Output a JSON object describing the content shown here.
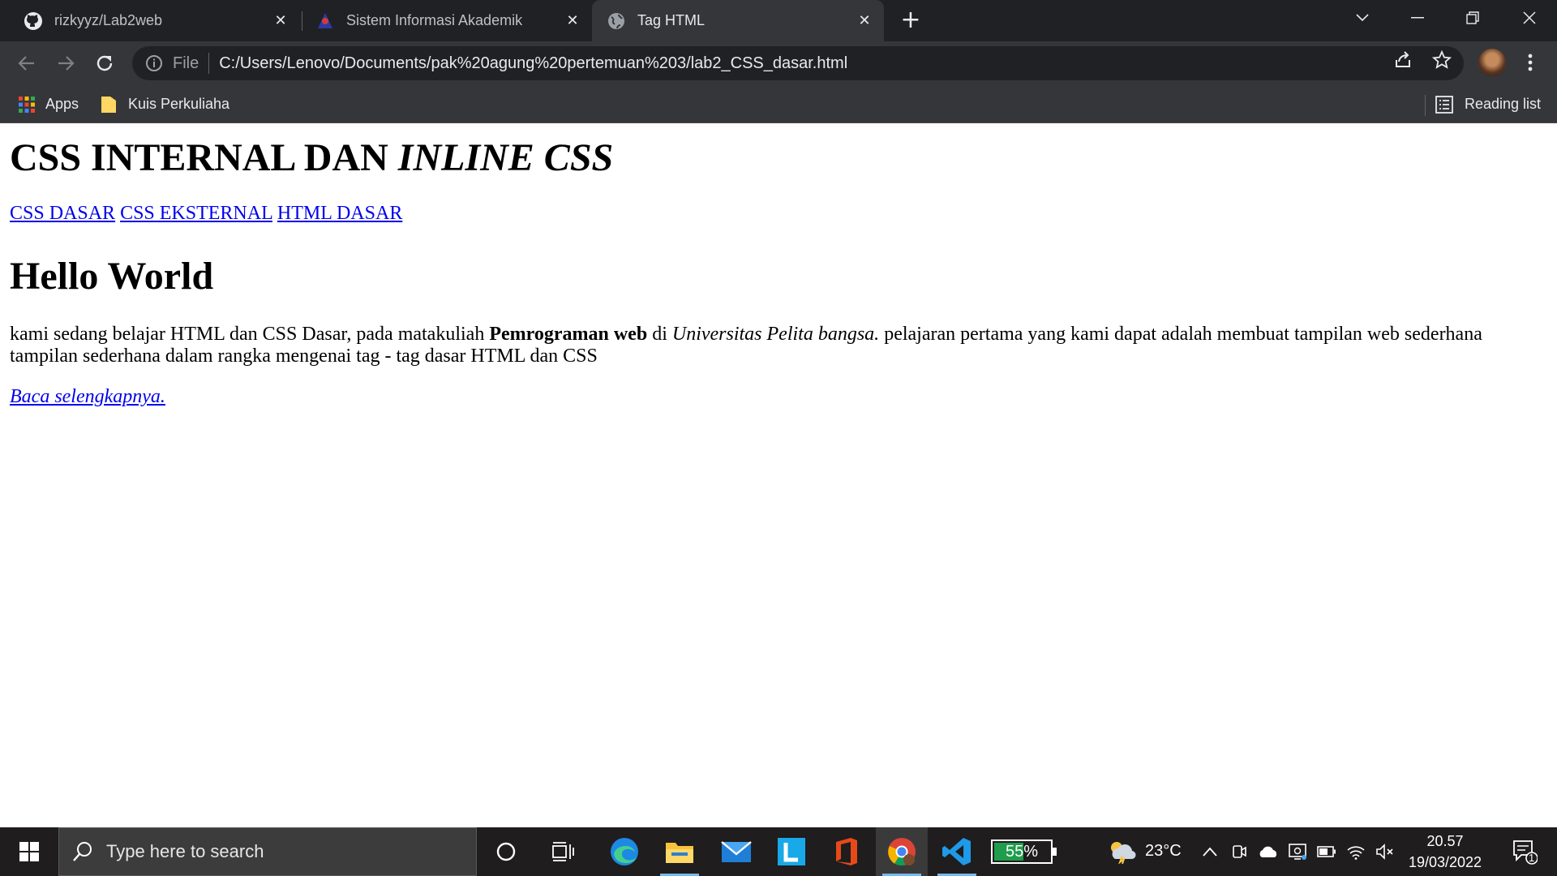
{
  "browser": {
    "tabs": [
      {
        "title": "rizkyyz/Lab2web",
        "icon": "github-icon",
        "active": false
      },
      {
        "title": "Sistem Informasi Akademik",
        "icon": "campus-logo-icon",
        "active": false
      },
      {
        "title": "Tag HTML",
        "icon": "globe-icon",
        "active": true
      }
    ],
    "address": {
      "scheme_label": "File",
      "url": "C:/Users/Lenovo/Documents/pak%20agung%20pertemuan%203/lab2_CSS_dasar.html"
    },
    "bookmarks": [
      {
        "label": "Apps",
        "icon": "apps-grid-icon"
      },
      {
        "label": "Kuis Perkuliaha",
        "icon": "folder-icon"
      }
    ],
    "reading_list_label": "Reading list"
  },
  "page": {
    "heading_plain": "CSS INTERNAL DAN ",
    "heading_italic": "INLINE CSS",
    "nav_links": [
      "CSS DASAR",
      "CSS EKSTERNAL",
      "HTML DASAR"
    ],
    "subheading": "Hello World",
    "paragraph": {
      "part1": "kami sedang belajar HTML dan CSS Dasar, pada matakuliah ",
      "bold": "Pemrograman web",
      "part2": " di ",
      "italic": "Universitas Pelita bangsa.",
      "part3": " pelajaran pertama yang kami dapat adalah membuat tampilan web sederhana tampilan sederhana dalam rangka mengenai tag - tag dasar HTML dan CSS"
    },
    "read_more": "Baca selengkapnya."
  },
  "taskbar": {
    "search_placeholder": "Type here to search",
    "battery_percent": 55,
    "battery_label": "55%",
    "weather": "23°C",
    "time": "20.57",
    "date": "19/03/2022",
    "notification_count": "1",
    "pinned": [
      "cortana-icon",
      "task-view-icon",
      "edge-icon",
      "file-explorer-icon",
      "mail-icon",
      "l-app-icon",
      "office-icon",
      "chrome-icon",
      "vscode-icon"
    ]
  },
  "colors": {
    "tab_bar": "#202124",
    "toolbar": "#35363a",
    "link": "#0000ee",
    "taskbar": "#1f1d1e",
    "battery_fill": "#1f9d4c"
  }
}
